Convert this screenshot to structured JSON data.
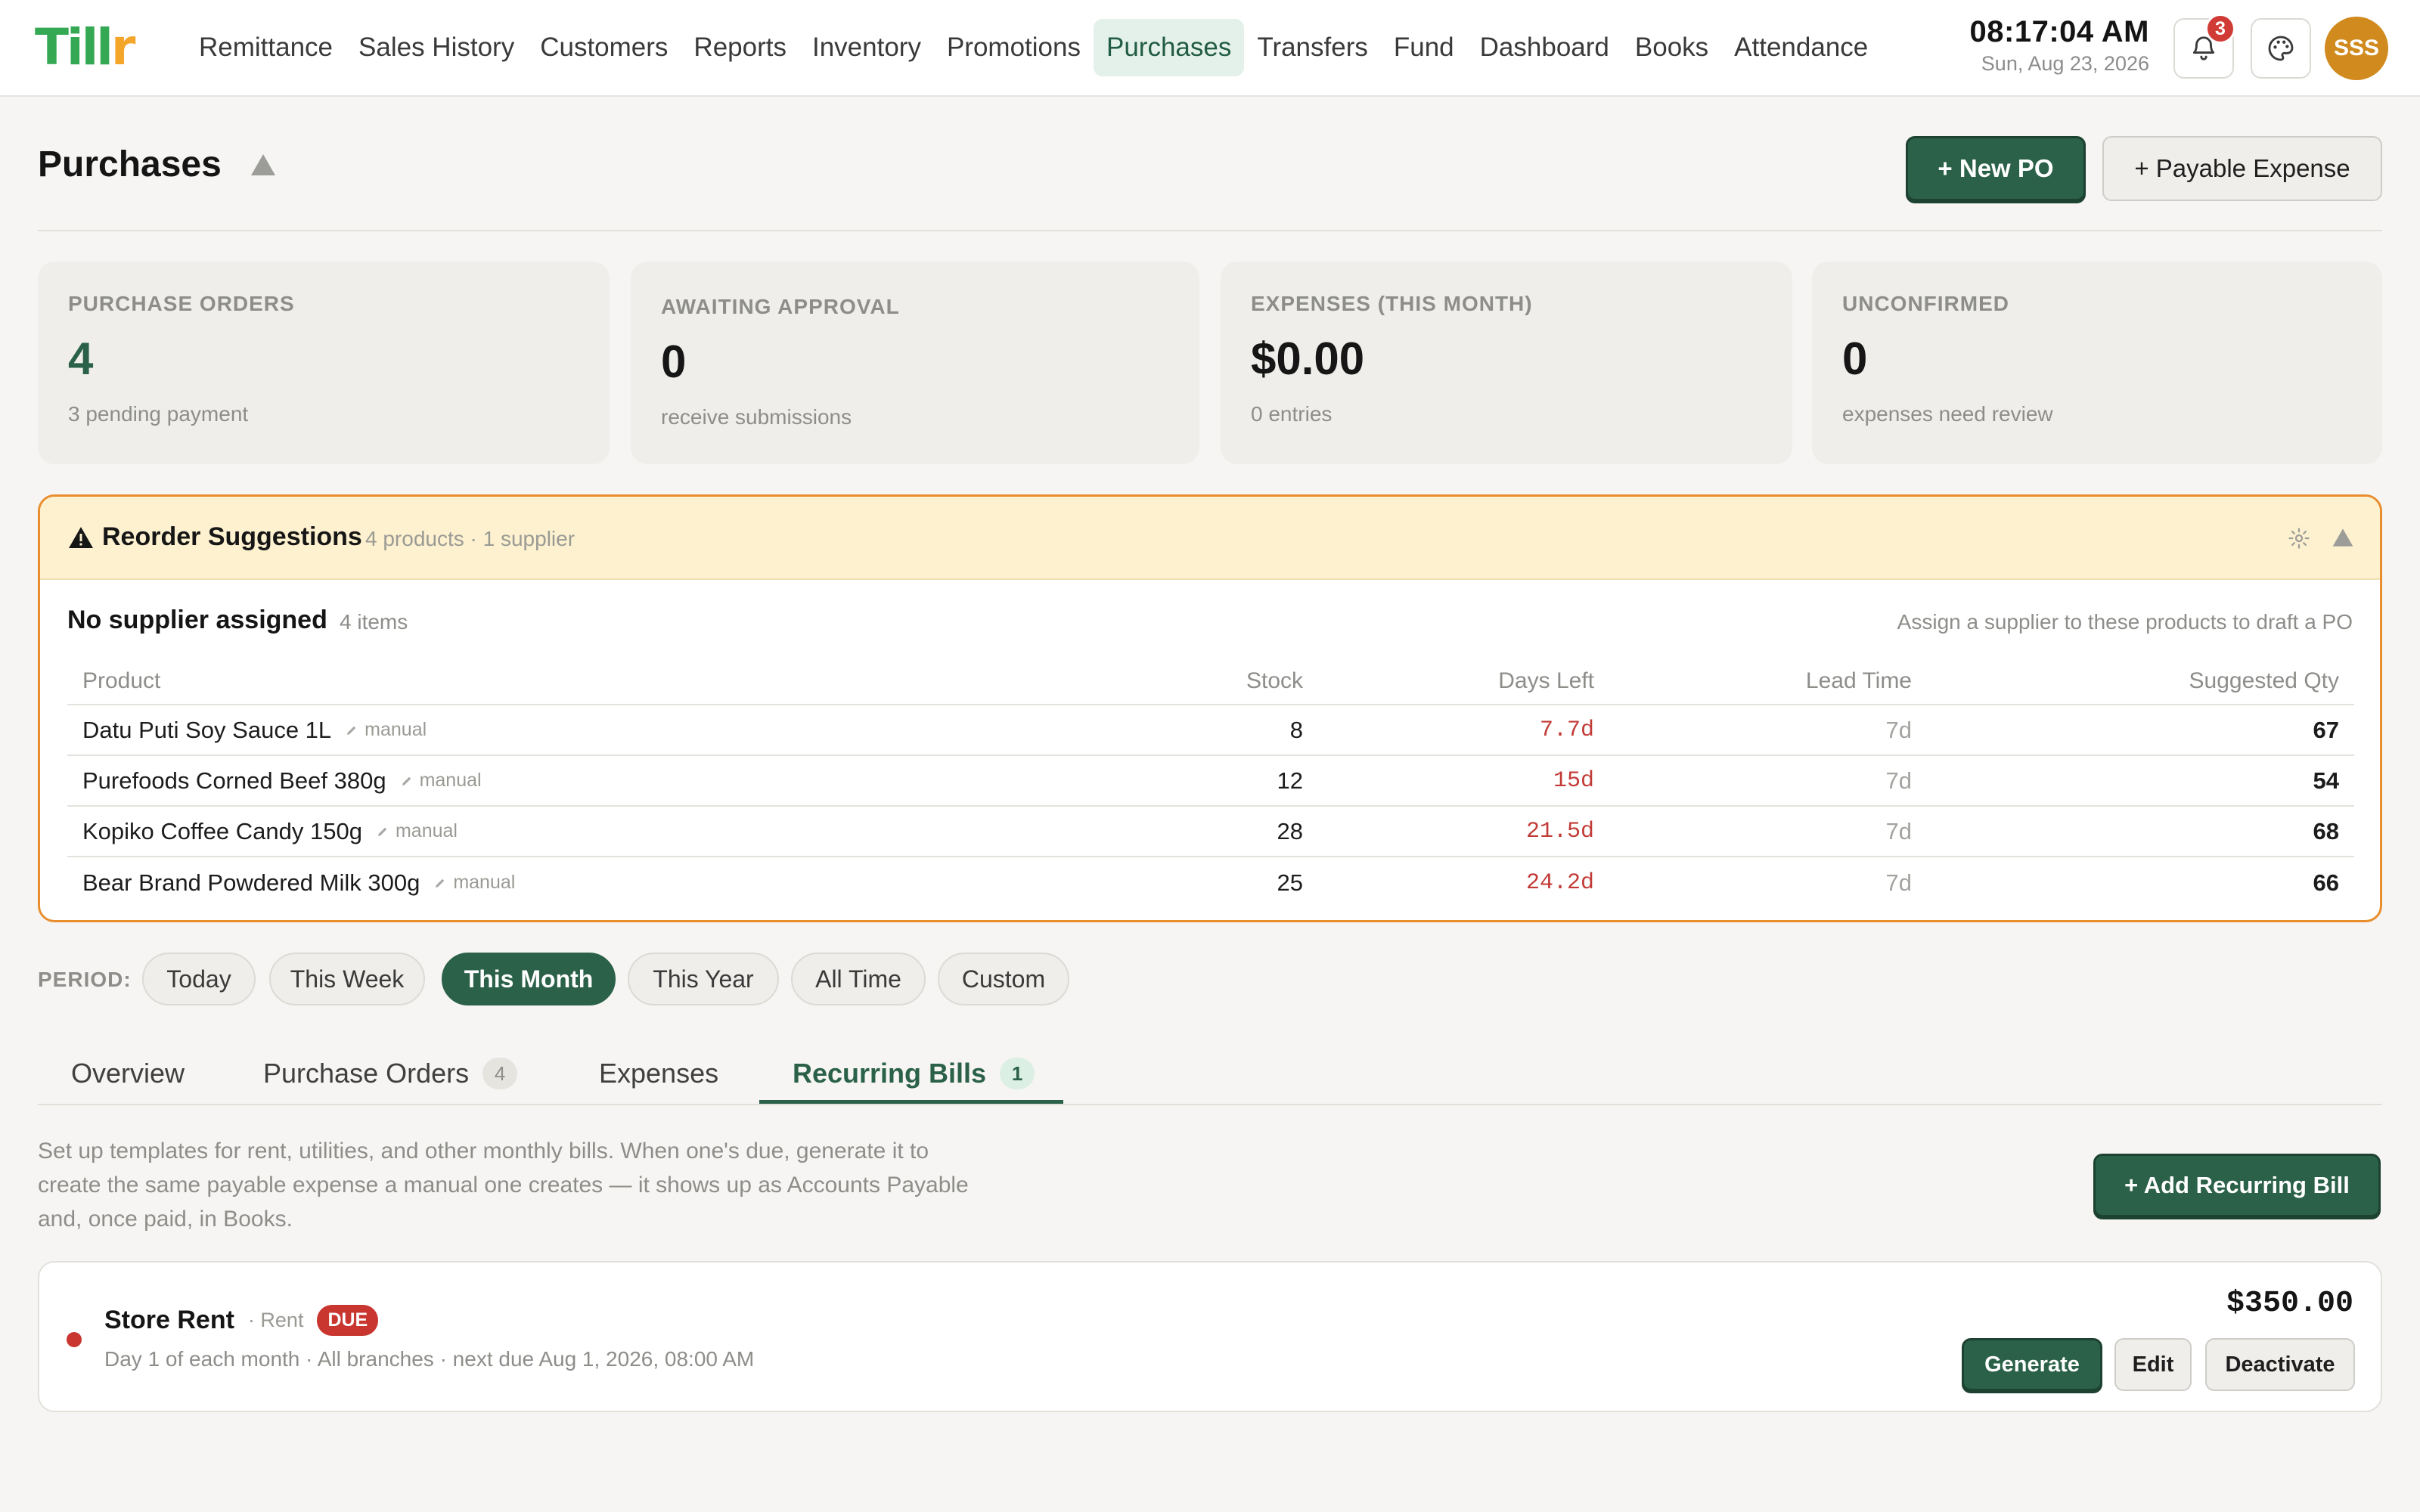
{
  "app": {
    "logo_text": "Tillr"
  },
  "nav": {
    "items": [
      {
        "label": "Remittance",
        "active": false
      },
      {
        "label": "Sales History",
        "active": false
      },
      {
        "label": "Customers",
        "active": false
      },
      {
        "label": "Reports",
        "active": false
      },
      {
        "label": "Inventory",
        "active": false
      },
      {
        "label": "Promotions",
        "active": false
      },
      {
        "label": "Purchases",
        "active": true
      },
      {
        "label": "Transfers",
        "active": false
      },
      {
        "label": "Fund",
        "active": false
      },
      {
        "label": "Dashboard",
        "active": false
      },
      {
        "label": "Books",
        "active": false
      },
      {
        "label": "Attendance",
        "active": false
      }
    ]
  },
  "clock": {
    "time": "08:17:04 AM",
    "date": "Sun, Aug 23, 2026"
  },
  "notifications": {
    "count": "3",
    "icon": "bell-icon"
  },
  "theme": {
    "icon": "palette-icon"
  },
  "user": {
    "initials": "SSS"
  },
  "header": {
    "title": "Purchases",
    "new_po_label": "+ New PO",
    "payable_expense_label": "+ Payable Expense"
  },
  "stats": [
    {
      "label": "PURCHASE ORDERS",
      "value": "4",
      "sub": "3 pending payment"
    },
    {
      "label": "AWAITING APPROVAL",
      "value": "0",
      "sub": "receive submissions"
    },
    {
      "label": "EXPENSES (THIS MONTH)",
      "value": "$0.00",
      "sub": "0 entries"
    },
    {
      "label": "UNCONFIRMED",
      "value": "0",
      "sub": "expenses need review"
    }
  ],
  "reorder": {
    "title": "Reorder Suggestions",
    "meta": "4 products · 1 supplier",
    "group_title": "No supplier assigned",
    "group_count": "4 items",
    "group_hint": "Assign a supplier to these products to draft a PO",
    "columns": {
      "product": "Product",
      "stock": "Stock",
      "days_left": "Days Left",
      "lead_time": "Lead Time",
      "suggested_qty": "Suggested Qty"
    },
    "rows": [
      {
        "product": "Datu Puti Soy Sauce 1L",
        "tag": "manual",
        "stock": "8",
        "days_left": "7.7d",
        "lead_time": "7d",
        "qty": "67"
      },
      {
        "product": "Purefoods Corned Beef 380g",
        "tag": "manual",
        "stock": "12",
        "days_left": "15d",
        "lead_time": "7d",
        "qty": "54"
      },
      {
        "product": "Kopiko Coffee Candy 150g",
        "tag": "manual",
        "stock": "28",
        "days_left": "21.5d",
        "lead_time": "7d",
        "qty": "68"
      },
      {
        "product": "Bear Brand Powdered Milk 300g",
        "tag": "manual",
        "stock": "25",
        "days_left": "24.2d",
        "lead_time": "7d",
        "qty": "66"
      }
    ]
  },
  "period": {
    "label": "PERIOD:",
    "options": [
      "Today",
      "This Week",
      "This Month",
      "This Year",
      "All Time",
      "Custom"
    ],
    "selected": "This Month"
  },
  "tabs": [
    {
      "label": "Overview",
      "count": ""
    },
    {
      "label": "Purchase Orders",
      "count": "4"
    },
    {
      "label": "Expenses",
      "count": ""
    },
    {
      "label": "Recurring Bills",
      "count": "1"
    }
  ],
  "recurring": {
    "intro": "Set up templates for rent, utilities, and other monthly bills. When one's due, generate it to create the same payable expense a manual one creates — it shows up as Accounts Payable and, once paid, in Books.",
    "add_label": "+ Add Recurring Bill",
    "bills": [
      {
        "name": "Store Rent",
        "category": "· Rent",
        "status": "DUE",
        "schedule": "Day 1 of each month · All branches · next due Aug 1, 2026, 08:00 AM",
        "amount": "$350.00",
        "generate_label": "Generate",
        "edit_label": "Edit",
        "deactivate_label": "Deactivate"
      }
    ]
  },
  "colors": {
    "brand_green": "#2b6148",
    "warning_orange": "#e88e2e",
    "danger_red": "#c8362f",
    "avatar_orange": "#d18a1e"
  }
}
